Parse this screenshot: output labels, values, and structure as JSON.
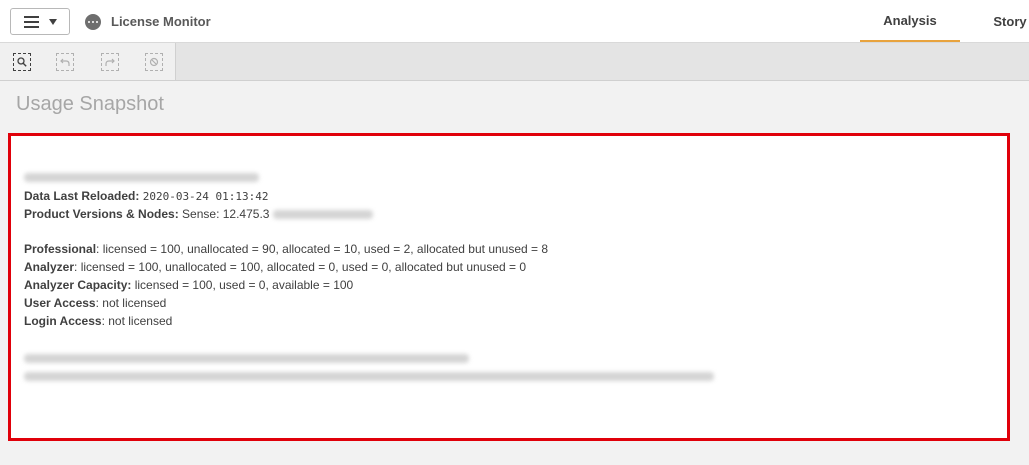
{
  "header": {
    "app_title": "License Monitor",
    "tabs": [
      {
        "label": "Analysis",
        "active": true
      },
      {
        "label": "Story",
        "active": false
      }
    ],
    "accent_color": "#e8a33d"
  },
  "toolbar": {
    "tools": [
      {
        "icon": "smart-search-icon",
        "enabled": true
      },
      {
        "icon": "step-back-icon",
        "enabled": false
      },
      {
        "icon": "step-forward-icon",
        "enabled": false
      },
      {
        "icon": "clear-selections-icon",
        "enabled": false
      }
    ]
  },
  "sheet": {
    "title": "Usage Snapshot"
  },
  "snapshot": {
    "highlight_color": "#e0000a",
    "reload_label": "Data Last Reloaded:",
    "reload_value": "2020-03-24 01:13:42",
    "versions_label": "Product Versions & Nodes:",
    "versions_value": "Sense: 12.475.3",
    "professional_label": "Professional",
    "professional_value": ": licensed = 100, unallocated = 90, allocated = 10, used = 2, allocated but unused = 8",
    "analyzer_label": "Analyzer",
    "analyzer_value": ": licensed = 100, unallocated = 100, allocated = 0, used = 0, allocated but unused = 0",
    "capacity_label": "Analyzer Capacity:",
    "capacity_value": "licensed = 100, used = 0, available = 100",
    "user_access_label": "User Access",
    "user_access_value": ": not licensed",
    "login_access_label": "Login Access",
    "login_access_value": ": not licensed"
  }
}
